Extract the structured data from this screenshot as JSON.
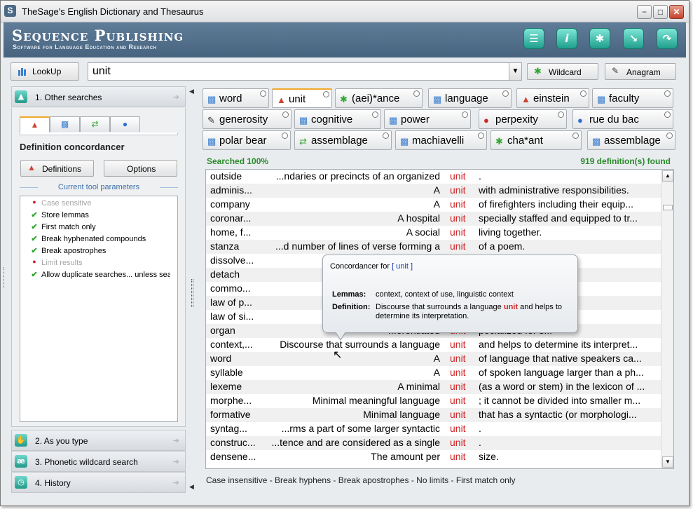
{
  "window": {
    "title": "TheSage's English Dictionary and Thesaurus",
    "min": "−",
    "max": "□",
    "close": "✕"
  },
  "banner": {
    "brand": "Sequence Publishing",
    "tagline": "Software for Language Education and Research"
  },
  "toolbar_icons": [
    "list-icon",
    "info-icon",
    "walker-icon",
    "arrow-down-right-icon",
    "exit-icon"
  ],
  "lookup": {
    "button": "LookUp",
    "query": "unit",
    "wildcard": "Wildcard",
    "anagram": "Anagram"
  },
  "accordion": [
    {
      "num": "1",
      "label": "Other searches",
      "accel": "1"
    },
    {
      "num": "2",
      "label": "As you type"
    },
    {
      "num": "3",
      "label": "Phonetic wildcard search"
    },
    {
      "num": "4",
      "label": "History"
    }
  ],
  "panel": {
    "title": "Definition concordancer",
    "definitions_btn": "Definitions",
    "options_btn": "Options",
    "params_title": "Current tool parameters",
    "params": [
      {
        "text": "Case sensitive",
        "on": false
      },
      {
        "text": "Store lemmas",
        "on": true
      },
      {
        "text": "First match only",
        "on": true
      },
      {
        "text": "Break hyphenated compounds",
        "on": true
      },
      {
        "text": "Break apostrophes",
        "on": true
      },
      {
        "text": "Limit results",
        "on": false
      },
      {
        "text": "Allow duplicate searches... unless sea...",
        "on": true
      }
    ]
  },
  "word_tabs": [
    [
      "word",
      "unit",
      "(aei)*ance",
      "language",
      "einstein",
      "faculty"
    ],
    [
      "generosity",
      "cognitive",
      "power",
      "perpexity",
      "rue du bac"
    ],
    [
      "polar bear",
      "assemblage",
      "machiavelli",
      "cha*ant",
      "assemblage"
    ]
  ],
  "status": {
    "searched": "Searched 100%",
    "found": "919 definition(s) found"
  },
  "keyword": "unit",
  "rows": [
    [
      "outside",
      "...ndaries or precincts of an organized",
      "."
    ],
    [
      "adminis...",
      "A",
      "with administrative responsibilities."
    ],
    [
      "company",
      "A",
      "of firefighters including their equip..."
    ],
    [
      "coronar...",
      "A hospital",
      "specially staffed and equipped to tr..."
    ],
    [
      "home, f...",
      "A social",
      "living together."
    ],
    [
      "stanza",
      "...d number of lines of verse forming a",
      "of a poem."
    ],
    [
      "dissolve...",
      "Stop fu",
      ""
    ],
    [
      "detach",
      "",
      "ally for a speci..."
    ],
    [
      "commo...",
      "...imilar mar",
      ""
    ],
    [
      "law of p...",
      "...erceived a",
      ""
    ],
    [
      "law of si...",
      "...erceived a",
      ""
    ],
    [
      "organ",
      "...erentiated",
      "pecialized for s..."
    ],
    [
      "context,...",
      "Discourse that surrounds a language",
      "and helps to determine its interpret..."
    ],
    [
      "word",
      "A",
      "of language that native speakers ca..."
    ],
    [
      "syllable",
      "A",
      "of spoken language larger than a ph..."
    ],
    [
      "lexeme",
      "A minimal",
      "(as a word or stem) in the lexicon of ..."
    ],
    [
      "morphe...",
      "Minimal meaningful language",
      "; it cannot be divided into smaller m..."
    ],
    [
      "formative",
      "Minimal language",
      "that has a syntactic (or morphologi..."
    ],
    [
      "syntag...",
      "...rms a part of some larger syntactic",
      "."
    ],
    [
      "construc...",
      "...tence and are considered as a single",
      "."
    ],
    [
      "densene...",
      "The amount per",
      "size."
    ]
  ],
  "tooltip": {
    "title_prefix": "Concordancer for",
    "title_word": "[ unit ]",
    "lemmas_label": "Lemmas:",
    "lemmas": "context, context of use, linguistic context",
    "definition_label": "Definition:",
    "def_before": "Discourse that surrounds a language",
    "def_word": "unit",
    "def_after": "and helps to",
    "def_line2": "determine its interpretation."
  },
  "bottom_status": "Case insensitive - Break hyphens - Break apostrophes - No limits - First match only"
}
